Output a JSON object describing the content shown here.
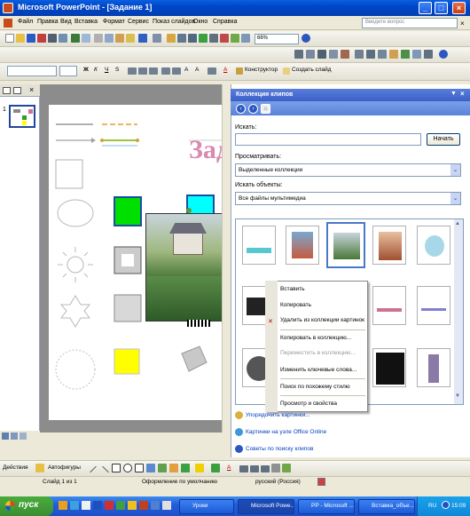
{
  "window": {
    "title": "Microsoft PowerPoint - [Задание 1]",
    "min": "_",
    "max": "□",
    "close": "×"
  },
  "menu": [
    "Файл",
    "Правка",
    "Вид",
    "Вставка",
    "Формат",
    "Сервис",
    "Показ слайдов",
    "Окно",
    "Справка"
  ],
  "help_box": {
    "placeholder": "Введите вопрос"
  },
  "toolbar1": {
    "zoom": "66%"
  },
  "toolbar3": {
    "designer": "Конструктор",
    "create_slide": "Создать слайд"
  },
  "slide": {
    "title_fragment": "Зада"
  },
  "slide_thumb": {
    "number": "1"
  },
  "taskpane": {
    "title": "Коллекция клипов",
    "search_label": "Искать:",
    "search_value": "",
    "search_button": "Начать",
    "browse_label": "Просматривать:",
    "browse_value": "Выделенные коллекции",
    "find_label": "Искать объекты:",
    "find_value": "Все файлы мультимедиа",
    "links": [
      "Упорядочить картинки...",
      "Картинки на узле Office Online",
      "Советы по поиску клипов"
    ]
  },
  "context_menu": [
    {
      "label": "Вставить",
      "enabled": true
    },
    {
      "label": "Копировать",
      "enabled": true
    },
    {
      "label": "Удалить из коллекции картинок",
      "enabled": true
    },
    {
      "label": "Копировать в коллекцию...",
      "enabled": true
    },
    {
      "label": "Переместить в коллекцию...",
      "enabled": false
    },
    {
      "label": "Изменить ключевые слова...",
      "enabled": true
    },
    {
      "label": "Поиск по похожему стилю",
      "enabled": true
    },
    {
      "label": "Просмотр и свойства",
      "enabled": true
    }
  ],
  "drawbar": {
    "actions": "Действия",
    "autoshapes": "Автофигуры"
  },
  "status": {
    "slide": "Слайд 1 из 1",
    "design": "Оформление по умолчанию",
    "language": "русский (Россия)"
  },
  "taskbar": {
    "start": "пуск",
    "tasks": [
      "Уроки",
      "Microsoft Powe...",
      "PP - Microsoft ...",
      "Вставка_объе..."
    ],
    "lang": "RU",
    "clock": "15:09"
  },
  "colors": {
    "title_bar": "#0046c8",
    "taskpane_header": "#3a60c8",
    "start_green": "#3a8e30"
  }
}
